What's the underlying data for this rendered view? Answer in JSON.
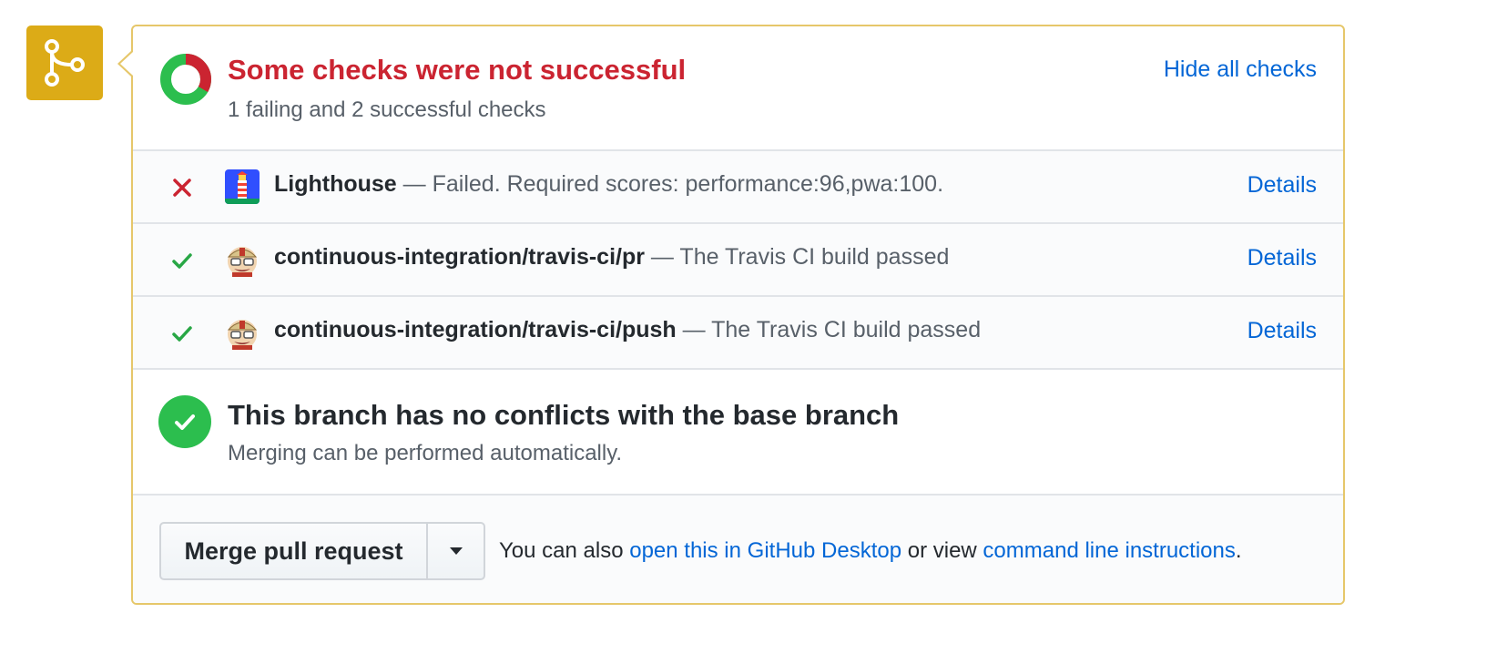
{
  "checks_summary": {
    "title": "Some checks were not successful",
    "subtitle": "1 failing and 2 successful checks",
    "hide_label": "Hide all checks",
    "failing_count": 1,
    "successful_count": 2,
    "colors": {
      "fail": "#cb2431",
      "success": "#2cbe4e"
    }
  },
  "checks": [
    {
      "status": "failed",
      "name": "Lighthouse",
      "description": " — Failed. Required scores: performance:96,pwa:100.",
      "details_label": "Details",
      "avatar": "lighthouse-avatar"
    },
    {
      "status": "passed",
      "name": "continuous-integration/travis-ci/pr",
      "description": " — The Travis CI build passed",
      "details_label": "Details",
      "avatar": "travis-ci-avatar"
    },
    {
      "status": "passed",
      "name": "continuous-integration/travis-ci/push",
      "description": " — The Travis CI build passed",
      "details_label": "Details",
      "avatar": "travis-ci-avatar"
    }
  ],
  "branch_status": {
    "title": "This branch has no conflicts with the base branch",
    "subtitle": "Merging can be performed automatically."
  },
  "merge": {
    "button_label": "Merge pull request",
    "note_prefix": "You can also ",
    "desktop_link": "open this in GitHub Desktop",
    "note_middle": " or view ",
    "cli_link": "command line instructions",
    "note_suffix": "."
  },
  "icons": {
    "merge": "git-merge-icon",
    "summary": "status-donut-icon",
    "fail": "x-icon",
    "pass": "check-icon",
    "dropdown": "triangle-down-icon"
  },
  "colors": {
    "accent": "#dcab17",
    "link": "#0366d6",
    "border": "#e6c76a"
  }
}
